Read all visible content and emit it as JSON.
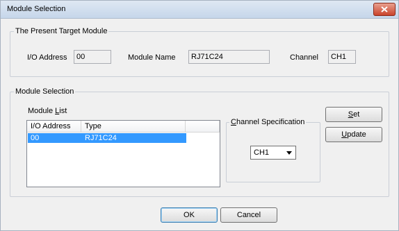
{
  "window": {
    "title": "Module Selection",
    "close_icon": "close-icon"
  },
  "present": {
    "group_label": "The Present Target Module",
    "io_label": "I/O Address",
    "io_value": "00",
    "name_label": "Module Name",
    "name_value": "RJ71C24",
    "channel_label": "Channel",
    "channel_value": "CH1"
  },
  "selection": {
    "group_label": "Module Selection",
    "list_label_pre": "Module ",
    "list_label_key": "L",
    "list_label_post": "ist",
    "columns": [
      "I/O Address",
      "Type",
      ""
    ],
    "rows": [
      {
        "io": "00",
        "type": "RJ71C24",
        "selected": true
      }
    ],
    "channel_group_key": "C",
    "channel_group_rest": "hannel Specification",
    "channel_selected": "CH1",
    "set_key": "S",
    "set_rest": "et",
    "update_key": "U",
    "update_rest": "pdate"
  },
  "footer": {
    "ok_label": "OK",
    "cancel_label": "Cancel"
  }
}
